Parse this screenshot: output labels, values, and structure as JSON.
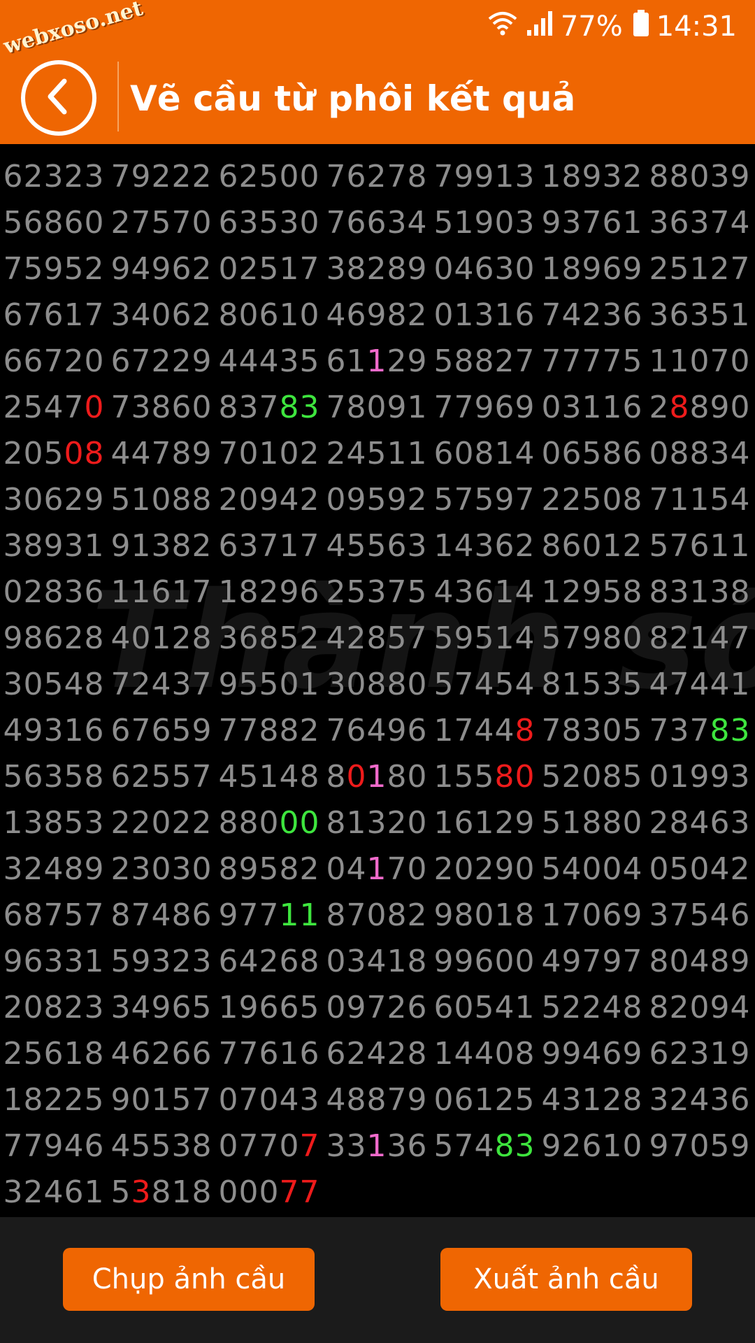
{
  "watermark": "webxoso.net",
  "status_bar": {
    "battery": "77%",
    "time": "14:31"
  },
  "header": {
    "title": "Vẽ cầu từ phôi kết quả"
  },
  "background_watermark": "Thành số",
  "colors": {
    "header": "#ef6602",
    "red": "#ee1b1b",
    "green": "#3ee53e",
    "pink": "#f06acb",
    "default": "#8d8d8d"
  },
  "footer": {
    "capture_label": "Chụp ảnh cầu",
    "export_label": "Xuất ảnh cầu"
  },
  "grid": [
    [
      [
        [
          "62323",
          ""
        ]
      ],
      [
        [
          "79222",
          ""
        ]
      ],
      [
        [
          "62500",
          ""
        ]
      ],
      [
        [
          "76278",
          ""
        ]
      ],
      [
        [
          "79913",
          ""
        ]
      ],
      [
        [
          "18932",
          ""
        ]
      ],
      [
        [
          "88039",
          ""
        ]
      ]
    ],
    [
      [
        [
          "56860",
          ""
        ]
      ],
      [
        [
          "27570",
          ""
        ]
      ],
      [
        [
          "63530",
          ""
        ]
      ],
      [
        [
          "76634",
          ""
        ]
      ],
      [
        [
          "51903",
          ""
        ]
      ],
      [
        [
          "93761",
          ""
        ]
      ],
      [
        [
          "36374",
          ""
        ]
      ]
    ],
    [
      [
        [
          "75952",
          ""
        ]
      ],
      [
        [
          "94962",
          ""
        ]
      ],
      [
        [
          "02517",
          ""
        ]
      ],
      [
        [
          "38289",
          ""
        ]
      ],
      [
        [
          "04630",
          ""
        ]
      ],
      [
        [
          "18969",
          ""
        ]
      ],
      [
        [
          "25127",
          ""
        ]
      ]
    ],
    [
      [
        [
          "67617",
          ""
        ]
      ],
      [
        [
          "34062",
          ""
        ]
      ],
      [
        [
          "80610",
          ""
        ]
      ],
      [
        [
          "46982",
          ""
        ]
      ],
      [
        [
          "01316",
          ""
        ]
      ],
      [
        [
          "74236",
          ""
        ]
      ],
      [
        [
          "36351",
          ""
        ]
      ]
    ],
    [
      [
        [
          "66720",
          ""
        ]
      ],
      [
        [
          "67229",
          ""
        ]
      ],
      [
        [
          "44435",
          ""
        ]
      ],
      [
        [
          "61",
          ""
        ],
        [
          "1",
          "pink"
        ],
        [
          "29",
          ""
        ]
      ],
      [
        [
          "58827",
          ""
        ]
      ],
      [
        [
          "77775",
          ""
        ]
      ],
      [
        [
          "11070",
          ""
        ]
      ]
    ],
    [
      [
        [
          "2547",
          ""
        ],
        [
          "0",
          "red"
        ]
      ],
      [
        [
          "73860",
          ""
        ]
      ],
      [
        [
          "837",
          ""
        ],
        [
          "83",
          "green"
        ]
      ],
      [
        [
          "78091",
          ""
        ]
      ],
      [
        [
          "77969",
          ""
        ]
      ],
      [
        [
          "03116",
          ""
        ]
      ],
      [
        [
          "2",
          ""
        ],
        [
          "8",
          "red"
        ],
        [
          "890",
          ""
        ]
      ]
    ],
    [
      [
        [
          "205",
          ""
        ],
        [
          "08",
          "red"
        ]
      ],
      [
        [
          "44789",
          ""
        ]
      ],
      [
        [
          "70102",
          ""
        ]
      ],
      [
        [
          "24511",
          ""
        ]
      ],
      [
        [
          "60814",
          ""
        ]
      ],
      [
        [
          "06586",
          ""
        ]
      ],
      [
        [
          "08834",
          ""
        ]
      ]
    ],
    [
      [
        [
          "30629",
          ""
        ]
      ],
      [
        [
          "51088",
          ""
        ]
      ],
      [
        [
          "20942",
          ""
        ]
      ],
      [
        [
          "09592",
          ""
        ]
      ],
      [
        [
          "57597",
          ""
        ]
      ],
      [
        [
          "22508",
          ""
        ]
      ],
      [
        [
          "71154",
          ""
        ]
      ]
    ],
    [
      [
        [
          "38931",
          ""
        ]
      ],
      [
        [
          "91382",
          ""
        ]
      ],
      [
        [
          "63717",
          ""
        ]
      ],
      [
        [
          "45563",
          ""
        ]
      ],
      [
        [
          "14362",
          ""
        ]
      ],
      [
        [
          "86012",
          ""
        ]
      ],
      [
        [
          "57611",
          ""
        ]
      ]
    ],
    [
      [
        [
          "02836",
          ""
        ]
      ],
      [
        [
          "11617",
          ""
        ]
      ],
      [
        [
          "18296",
          ""
        ]
      ],
      [
        [
          "25375",
          ""
        ]
      ],
      [
        [
          "43614",
          ""
        ]
      ],
      [
        [
          "12958",
          ""
        ]
      ],
      [
        [
          "83138",
          ""
        ]
      ]
    ],
    [
      [
        [
          "98628",
          ""
        ]
      ],
      [
        [
          "40128",
          ""
        ]
      ],
      [
        [
          "36852",
          ""
        ]
      ],
      [
        [
          "42857",
          ""
        ]
      ],
      [
        [
          "59514",
          ""
        ]
      ],
      [
        [
          "57980",
          ""
        ]
      ],
      [
        [
          "82147",
          ""
        ]
      ]
    ],
    [
      [
        [
          "30548",
          ""
        ]
      ],
      [
        [
          "72437",
          ""
        ]
      ],
      [
        [
          "95501",
          ""
        ]
      ],
      [
        [
          "30880",
          ""
        ]
      ],
      [
        [
          "57454",
          ""
        ]
      ],
      [
        [
          "81535",
          ""
        ]
      ],
      [
        [
          "47441",
          ""
        ]
      ]
    ],
    [
      [
        [
          "49316",
          ""
        ]
      ],
      [
        [
          "67659",
          ""
        ]
      ],
      [
        [
          "77882",
          ""
        ]
      ],
      [
        [
          "76496",
          ""
        ]
      ],
      [
        [
          "1744",
          ""
        ],
        [
          "8",
          "red"
        ]
      ],
      [
        [
          "78305",
          ""
        ]
      ],
      [
        [
          "737",
          ""
        ],
        [
          "83",
          "green"
        ]
      ]
    ],
    [
      [
        [
          "56358",
          ""
        ]
      ],
      [
        [
          "62557",
          ""
        ]
      ],
      [
        [
          "45148",
          ""
        ]
      ],
      [
        [
          "8",
          ""
        ],
        [
          "0",
          "red"
        ],
        [
          "1",
          "pink"
        ],
        [
          "80",
          ""
        ]
      ],
      [
        [
          "155",
          ""
        ],
        [
          "80",
          "red"
        ]
      ],
      [
        [
          "52085",
          ""
        ]
      ],
      [
        [
          "01993",
          ""
        ]
      ]
    ],
    [
      [
        [
          "13853",
          ""
        ]
      ],
      [
        [
          "22022",
          ""
        ]
      ],
      [
        [
          "880",
          ""
        ],
        [
          "00",
          "green"
        ]
      ],
      [
        [
          "81320",
          ""
        ]
      ],
      [
        [
          "16129",
          ""
        ]
      ],
      [
        [
          "51880",
          ""
        ]
      ],
      [
        [
          "28463",
          ""
        ]
      ]
    ],
    [
      [
        [
          "32489",
          ""
        ]
      ],
      [
        [
          "23030",
          ""
        ]
      ],
      [
        [
          "89582",
          ""
        ]
      ],
      [
        [
          "04",
          ""
        ],
        [
          "1",
          "pink"
        ],
        [
          "70",
          ""
        ]
      ],
      [
        [
          "20290",
          ""
        ]
      ],
      [
        [
          "54004",
          ""
        ]
      ],
      [
        [
          "05042",
          ""
        ]
      ]
    ],
    [
      [
        [
          "68757",
          ""
        ]
      ],
      [
        [
          "87486",
          ""
        ]
      ],
      [
        [
          "977",
          ""
        ],
        [
          "11",
          "green"
        ]
      ],
      [
        [
          "87082",
          ""
        ]
      ],
      [
        [
          "98018",
          ""
        ]
      ],
      [
        [
          "17069",
          ""
        ]
      ],
      [
        [
          "37546",
          ""
        ]
      ]
    ],
    [
      [
        [
          "96331",
          ""
        ]
      ],
      [
        [
          "59323",
          ""
        ]
      ],
      [
        [
          "64268",
          ""
        ]
      ],
      [
        [
          "03418",
          ""
        ]
      ],
      [
        [
          "99600",
          ""
        ]
      ],
      [
        [
          "49797",
          ""
        ]
      ],
      [
        [
          "80489",
          ""
        ]
      ]
    ],
    [
      [
        [
          "20823",
          ""
        ]
      ],
      [
        [
          "34965",
          ""
        ]
      ],
      [
        [
          "19665",
          ""
        ]
      ],
      [
        [
          "09726",
          ""
        ]
      ],
      [
        [
          "60541",
          ""
        ]
      ],
      [
        [
          "52248",
          ""
        ]
      ],
      [
        [
          "82094",
          ""
        ]
      ]
    ],
    [
      [
        [
          "25618",
          ""
        ]
      ],
      [
        [
          "46266",
          ""
        ]
      ],
      [
        [
          "77616",
          ""
        ]
      ],
      [
        [
          "62428",
          ""
        ]
      ],
      [
        [
          "14408",
          ""
        ]
      ],
      [
        [
          "99469",
          ""
        ]
      ],
      [
        [
          "62319",
          ""
        ]
      ]
    ],
    [
      [
        [
          "18225",
          ""
        ]
      ],
      [
        [
          "90157",
          ""
        ]
      ],
      [
        [
          "07043",
          ""
        ]
      ],
      [
        [
          "48879",
          ""
        ]
      ],
      [
        [
          "06125",
          ""
        ]
      ],
      [
        [
          "43128",
          ""
        ]
      ],
      [
        [
          "32436",
          ""
        ]
      ]
    ],
    [
      [
        [
          "77946",
          ""
        ]
      ],
      [
        [
          "45538",
          ""
        ]
      ],
      [
        [
          "0770",
          ""
        ],
        [
          "7",
          "red"
        ]
      ],
      [
        [
          "33",
          ""
        ],
        [
          "1",
          "pink"
        ],
        [
          "36",
          ""
        ]
      ],
      [
        [
          "574",
          ""
        ],
        [
          "83",
          "green"
        ]
      ],
      [
        [
          "92610",
          ""
        ]
      ],
      [
        [
          "97059",
          ""
        ]
      ]
    ],
    [
      [
        [
          "32461",
          ""
        ]
      ],
      [
        [
          "5",
          ""
        ],
        [
          "3",
          "red"
        ],
        [
          "818",
          ""
        ]
      ],
      [
        [
          "000",
          ""
        ],
        [
          "77",
          "red"
        ]
      ]
    ]
  ]
}
